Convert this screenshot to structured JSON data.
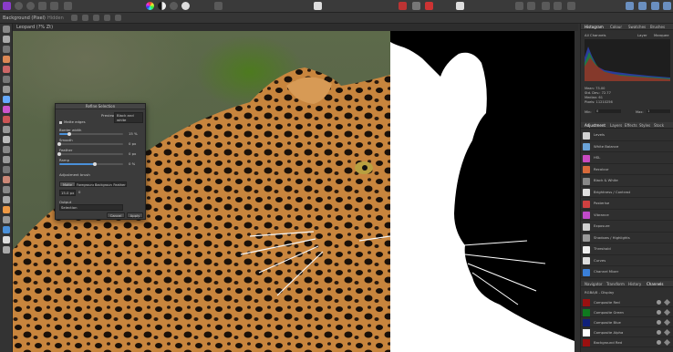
{
  "ctx": {
    "persona_left": "Background (Pixel)",
    "persona_right": "Hidden",
    "doc_tab": "Leopard (?% Zt)"
  },
  "dialog": {
    "title": "Refine Selection",
    "preview_label": "Preview",
    "preview_value": "Black and white",
    "matte_label": "Matte edges",
    "border_label": "Border width",
    "border_value": "15 %",
    "smooth_label": "Smooth",
    "smooth_value": "0 px",
    "feather_label": "Feather",
    "feather_value": "0 px",
    "ramp_label": "Ramp",
    "ramp_value": "0 %",
    "brush_label": "Adjustment brush",
    "brush_modes": [
      "Matte",
      "Foreground",
      "Background",
      "Feather"
    ],
    "brush_size": "15.0 px",
    "brush_size_extra": "0",
    "output_label": "Output",
    "output_value": "Selection",
    "cancel": "Cancel",
    "apply": "Apply",
    "progress": {
      "border": 0.15,
      "smooth": 0.0,
      "feather": 0.0,
      "ramp": 0.55
    }
  },
  "histogram": {
    "tabs": [
      "Histogram",
      "Colour",
      "Swatches",
      "Brushes"
    ],
    "channel": "All Channels",
    "layer_label": "Layer",
    "marquee_label": "Marquee",
    "stats": [
      "Mean: 73.00",
      "Std. Dev.: 72.77",
      "Median: 61",
      "Pixels: 11210256"
    ],
    "min_label": "Min:",
    "min_value": "0",
    "max_label": "Max:",
    "max_value": "1"
  },
  "adjustment": {
    "tabs": [
      "Adjustment",
      "Layers",
      "Effects",
      "Styles",
      "Stock"
    ],
    "items": [
      {
        "label": "Levels",
        "color": "#d0d0d0"
      },
      {
        "label": "White Balance",
        "color": "#6aa3d8"
      },
      {
        "label": "HSL",
        "color": "#c94ac0"
      },
      {
        "label": "Recolour",
        "color": "#d86a3a"
      },
      {
        "label": "Black & White",
        "color": "#888888"
      },
      {
        "label": "Brightness / Contrast",
        "color": "#e0e0e0"
      },
      {
        "label": "Posterise",
        "color": "#d04040"
      },
      {
        "label": "Vibrance",
        "color": "#c04ac9"
      },
      {
        "label": "Exposure",
        "color": "#cfcfcf"
      },
      {
        "label": "Shadows / Highlights",
        "color": "#999999"
      },
      {
        "label": "Threshold",
        "color": "#eeeeee"
      },
      {
        "label": "Curves",
        "color": "#dddddd"
      },
      {
        "label": "Channel Mixer",
        "color": "#3a7fd8"
      }
    ]
  },
  "channels": {
    "tabs": [
      "Navigator",
      "Transform",
      "History",
      "Channels"
    ],
    "header": "RGBA/8 - Display",
    "items": [
      {
        "label": "Composite Red",
        "color": "#9a1010"
      },
      {
        "label": "Composite Green",
        "color": "#0f7a1f"
      },
      {
        "label": "Composite Blue",
        "color": "#10207a"
      },
      {
        "label": "Composite Alpha",
        "color": "#ffffff"
      },
      {
        "label": "Background Red",
        "color": "#9a1010"
      }
    ]
  },
  "colors": {
    "accent": "#4a90d9",
    "mask": "#ffffff"
  }
}
